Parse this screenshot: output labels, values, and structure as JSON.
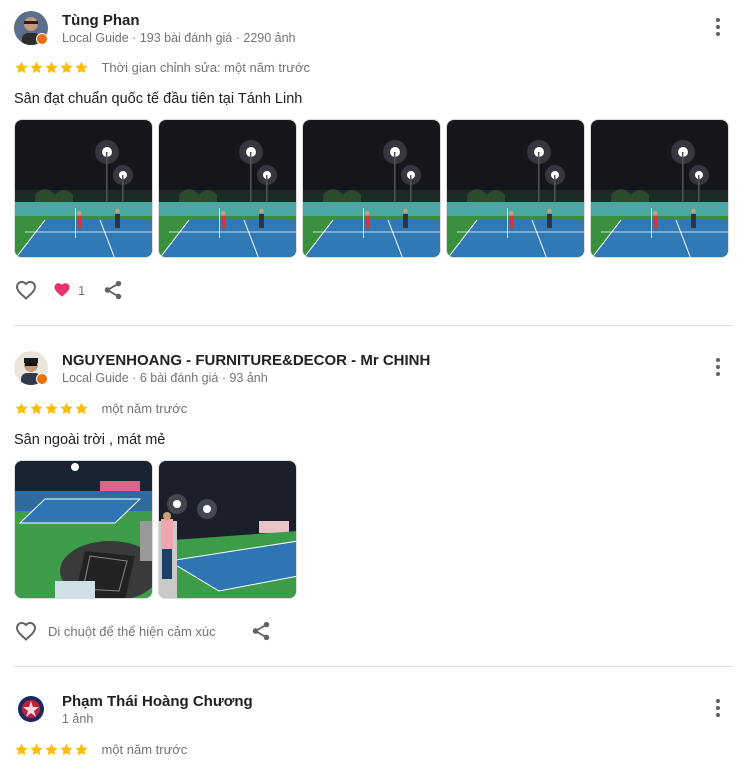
{
  "reviews": [
    {
      "name": "Tùng Phan",
      "meta": "Local Guide · 193 bài đánh giá · 2290 ảnh",
      "stars": 5,
      "time": "Thời gian chỉnh sửa: một năm trước",
      "text": "Sân đạt chuẩn quốc tế đầu tiên tại Tánh Linh",
      "photo_count": 5,
      "like_count": "1"
    },
    {
      "name": "NGUYENHOANG - FURNITURE&DECOR - Mr CHINH",
      "meta": "Local Guide · 6 bài đánh giá · 93 ảnh",
      "stars": 5,
      "time": "một năm trước",
      "text": "Sân ngoài trời , mát mẻ",
      "photo_count": 2,
      "react_hint": "Di chuột để thể hiện cảm xúc"
    },
    {
      "name": "Phạm Thái Hoàng Chương",
      "meta": "1 ảnh",
      "stars": 5,
      "time": "một năm trước"
    }
  ],
  "colors": {
    "star": "#fbbc04",
    "heart": "#e8336b",
    "icon": "#5f6368"
  }
}
